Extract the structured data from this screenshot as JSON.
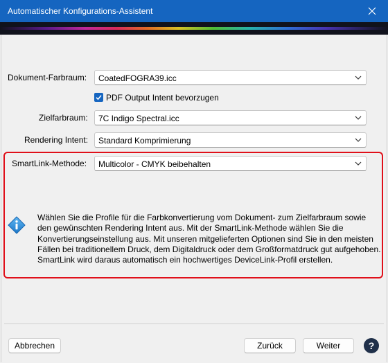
{
  "window": {
    "title": "Automatischer Konfigurations-Assistent"
  },
  "fields": {
    "document_color_space": {
      "label": "Dokument-Farbraum:",
      "value": "CoatedFOGRA39.icc"
    },
    "pdf_output_intent": {
      "label": "PDF Output Intent bevorzugen",
      "checked": true
    },
    "target_color_space": {
      "label": "Zielfarbraum:",
      "value": "7C Indigo Spectral.icc"
    },
    "rendering_intent": {
      "label": "Rendering Intent:",
      "value": "Standard Komprimierung"
    },
    "smartlink_method": {
      "label": "SmartLink-Methode:",
      "value": "Multicolor - CMYK beibehalten"
    }
  },
  "info": {
    "text": "Wählen Sie die Profile für die Farbkonvertierung vom Dokument- zum Zielfarbraum sowie den gewünschten Rendering Intent aus. Mit der SmartLink-Methode wählen Sie die Konvertierungseinstellung aus. Mit unseren mitgelieferten Optionen sind Sie in den meisten Fällen bei traditionellem Druck, dem Digitaldruck oder dem Großformatdruck gut aufgehoben. SmartLink wird daraus automatisch ein hochwertiges DeviceLink-Profil erstellen."
  },
  "buttons": {
    "cancel": "Abbrechen",
    "back": "Zurück",
    "next": "Weiter",
    "help": "?"
  },
  "colors": {
    "titlebar": "#1565c0",
    "highlight_border": "#e0101a",
    "banner": "#10121c"
  },
  "icons": {
    "close": "close-icon",
    "dropdown": "chevron-down-icon",
    "info": "info-icon",
    "check": "checkmark-icon"
  }
}
